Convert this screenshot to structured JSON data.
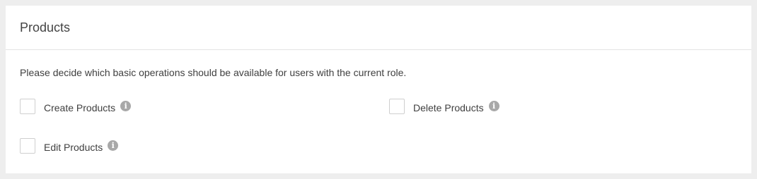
{
  "panel": {
    "title": "Products",
    "description": "Please decide which basic operations should be available for users with the current role."
  },
  "permissions": [
    {
      "label": "Create Products",
      "checked": false,
      "info_icon": "info-icon"
    },
    {
      "label": "Delete Products",
      "checked": false,
      "info_icon": "info-icon"
    },
    {
      "label": "Edit Products",
      "checked": false,
      "info_icon": "info-icon"
    }
  ],
  "icons": {
    "info_glyph": "i"
  }
}
